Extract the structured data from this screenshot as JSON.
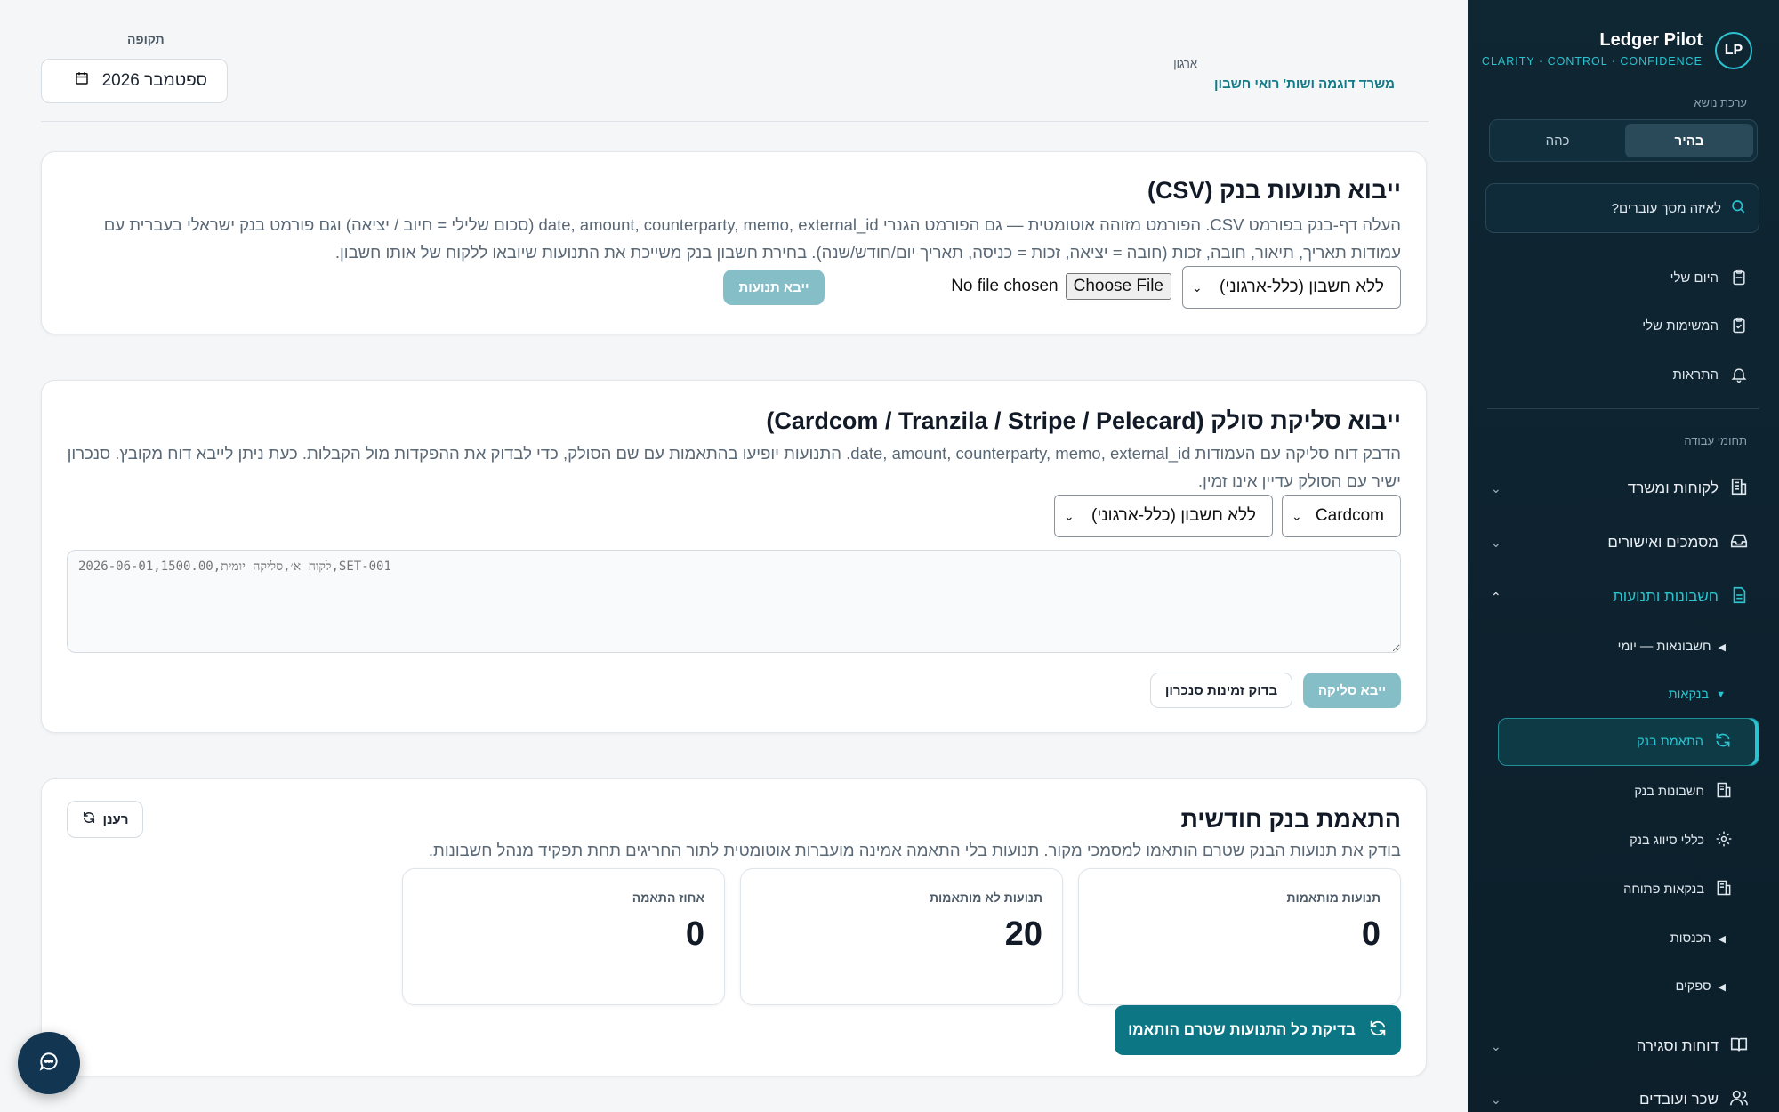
{
  "brand": {
    "logo": "LP",
    "name": "Ledger Pilot",
    "tagline": "CLARITY · CONTROL · CONFIDENCE"
  },
  "sidebar": {
    "theme_label": "ערכת נושא",
    "theme_light": "בהיר",
    "theme_dark": "כהה",
    "search_placeholder": "לאיזה מסך עוברים?",
    "quick": [
      {
        "label": "היום שלי",
        "icon": "clipboard-icon"
      },
      {
        "label": "המשימות שלי",
        "icon": "clipboard-check-icon"
      },
      {
        "label": "התראות",
        "icon": "bell-icon"
      }
    ],
    "section_label": "תחומי עבודה",
    "groups": {
      "clients": "לקוחות ומשרד",
      "documents": "מסמכים ואישורים",
      "accounting": "חשבונות ותנועות",
      "reports": "דוחות וסגירה",
      "payroll": "שכר ועובדים"
    },
    "accounting_sub": {
      "daily": "חשבונאות — יומי",
      "banking": "בנקאות",
      "reconciliation": "התאמת בנק",
      "bank_accounts": "חשבונות בנק",
      "classification_rules": "כללי סיווג בנק",
      "open_banking": "בנקאות פתוחה",
      "income": "הכנסות",
      "suppliers": "ספקים"
    }
  },
  "header": {
    "org_label": "ארגון",
    "org_name": "משרד דוגמה ושות' רואי חשבון",
    "period_label": "תקופה",
    "period_value": "ספטמבר 2026"
  },
  "csv_import": {
    "title": "ייבוא תנועות בנק (CSV)",
    "description": "העלה דף-בנק בפורמט CSV. הפורמט מזוהה אוטומטית — גם הפורמט הגנרי date, amount, counterparty, memo, external_id (סכום שלילי = חיוב / יציאה) וגם פורמט בנק ישראלי בעברית עם עמודות תאריך, תיאור, חובה, זכות (חובה = יציאה, זכות = כניסה, תאריך יום/חודש/שנה). בחירת חשבון בנק משייכת את התנועות שיובאו ללקוח של אותו חשבון.",
    "account_select": "ללא חשבון (כלל-ארגוני)",
    "choose_file": "Choose File",
    "no_file": "No file chosen",
    "import_button": "ייבא תנועות"
  },
  "settlement_import": {
    "title": "ייבוא סליקת סולק (Cardcom / Tranzila / Stripe / Pelecard)",
    "description": "הדבק דוח סליקה עם העמודות date, amount, counterparty, memo, external_id. התנועות יופיעו בהתאמות עם שם הסולק, כדי לבדוק את ההפקדות מול הקבלות. כעת ניתן לייבא דוח מקובץ. סנכרון ישיר עם הסולק עדיין אינו זמין.",
    "acquirer_select": "Cardcom",
    "account_select": "ללא חשבון (כלל-ארגוני)",
    "textarea_placeholder": "2026-06-01,1500.00,לקוח א׳,סליקה יומית,SET-001",
    "import_button": "ייבא סליקה",
    "check_sync_button": "בדוק זמינות סנכרון"
  },
  "reconciliation": {
    "title": "התאמת בנק חודשית",
    "description": "בודק את תנועות הבנק שטרם הותאמו למסמכי מקור. תנועות בלי התאמה אמינה מועברות אוטומטית לתור החריגים תחת תפקיד מנהל חשבונות.",
    "refresh_button": "רענן",
    "stats": [
      {
        "label": "תנועות מותאמות",
        "value": "0"
      },
      {
        "label": "תנועות לא מותאמות",
        "value": "20"
      },
      {
        "label": "אחוז התאמה",
        "value": "0"
      }
    ],
    "run_button": "בדיקת כל התנועות שטרם הותאמו"
  },
  "colors": {
    "sidebar_bg": "#0f2633",
    "accent": "#2ac3cf",
    "primary": "#0d7684",
    "org_text": "#127a88"
  }
}
